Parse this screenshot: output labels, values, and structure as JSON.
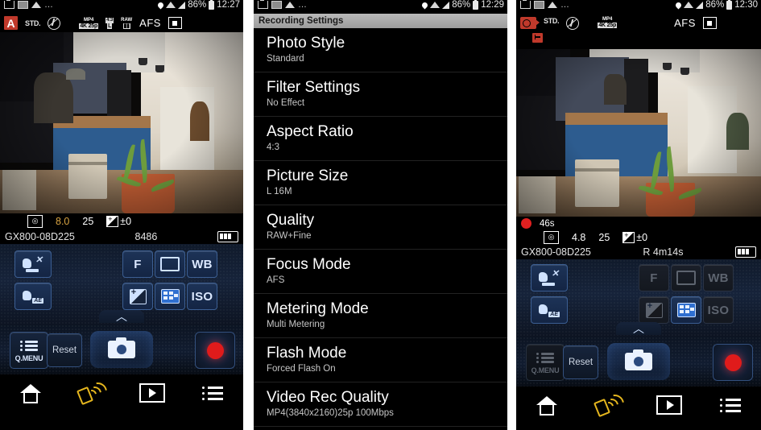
{
  "panels": [
    {
      "id": "live-view-photo",
      "statusbar": {
        "left_icons": [
          "download-icon",
          "keyboard-icon",
          "wifi-sync-icon",
          "more-dots"
        ],
        "location_icon": "location-pin-icon",
        "wifi_icon": "wifi-icon",
        "signal_icon": "signal-bars-icon",
        "battery_pct": "86%",
        "battery_icon": "battery-icon",
        "time": "12:27"
      },
      "camrow": {
        "mode_badge": "A",
        "photo_style": "STD.",
        "flash": "flash-off-icon",
        "video_tag_top": "MP4",
        "video_tag_bottom": "4K 25p",
        "ratio_tag_top": "4:3",
        "ratio_tag_bottom": "L",
        "raw_tag": "RAW",
        "focus_mode": "AFS",
        "af_area": "af-area-icon"
      },
      "exif": {
        "af_mini": "af-mode-icon",
        "aperture": "8.0",
        "shutter": "25",
        "ev_label": "±0",
        "device": "GX800-08D225",
        "remaining": "8486",
        "battery": "battery-icon"
      },
      "controls": {
        "touch_af_off": "touch-af-off-icon",
        "touch_ae": "touch-ae-icon",
        "aperture_btn": "F",
        "shutter_btn": "shutter-rect-icon",
        "wb_btn": "WB",
        "ev_btn": "exposure-comp-icon",
        "wb_shift_btn": "wb-grid-icon",
        "iso_btn": "ISO",
        "expand_arrow": "chevron-up-icon",
        "dimmed": []
      },
      "actions": {
        "qmenu": "Q.MENU",
        "reset": "Reset",
        "shutter": "camera-shutter-icon",
        "record": "record-icon",
        "qmenu_dim": false
      },
      "nav": [
        "home-icon",
        "wifi-remote-icon",
        "playback-icon",
        "menu-icon"
      ]
    },
    {
      "id": "recording-settings-menu",
      "statusbar": {
        "battery_pct": "86%",
        "time": "12:29"
      },
      "title": "Recording Settings",
      "items": [
        {
          "label": "Photo Style",
          "value": "Standard"
        },
        {
          "label": "Filter Settings",
          "value": "No Effect"
        },
        {
          "label": "Aspect Ratio",
          "value": "4:3"
        },
        {
          "label": "Picture Size",
          "value": "L 16M"
        },
        {
          "label": "Quality",
          "value": "RAW+Fine"
        },
        {
          "label": "Focus Mode",
          "value": "AFS"
        },
        {
          "label": "Metering Mode",
          "value": "Multi Metering"
        },
        {
          "label": "Flash Mode",
          "value": "Forced Flash On"
        },
        {
          "label": "Video Rec Quality",
          "value": "MP4(3840x2160)25p 100Mbps"
        }
      ]
    },
    {
      "id": "live-view-recording",
      "statusbar": {
        "battery_pct": "86%",
        "time": "12:30"
      },
      "camrow": {
        "mode_badge": "movie-mode-icon",
        "photo_style": "STD.",
        "flash": "flash-off-icon",
        "video_tag_top": "MP4",
        "video_tag_bottom": "4K 25p",
        "focus_mode": "AFS",
        "af_area": "af-area-icon",
        "card_icon": "card-write-icon"
      },
      "exif": {
        "rec_dot": "recording-dot",
        "elapsed": "46s",
        "af_mini": "af-mode-icon",
        "aperture": "4.8",
        "shutter": "25",
        "ev_label": "±0",
        "device": "GX800-08D225",
        "remaining": "R 4m14s",
        "battery": "battery-icon"
      },
      "controls": {
        "touch_af_off": "touch-af-off-icon",
        "touch_ae": "touch-ae-icon",
        "aperture_btn": "F",
        "shutter_btn": "shutter-rect-icon",
        "wb_btn": "WB",
        "ev_btn": "exposure-comp-icon",
        "wb_shift_btn": "wb-grid-icon",
        "iso_btn": "ISO",
        "expand_arrow": "chevron-up-icon"
      },
      "actions": {
        "qmenu": "Q.MENU",
        "reset": "Reset",
        "shutter": "camera-shutter-icon",
        "record": "record-icon",
        "qmenu_dim": true
      },
      "nav": [
        "home-icon",
        "wifi-remote-icon",
        "playback-icon",
        "menu-icon"
      ]
    }
  ],
  "colors": {
    "accent_red": "#c0392b",
    "record_red": "#e01b1b",
    "aperture_amber": "#d9a443",
    "wifi_yellow": "#e5b61e",
    "panel_bg": "#000000",
    "menu_title_bg": "#a8a8a8",
    "control_blue": "#16233a"
  }
}
